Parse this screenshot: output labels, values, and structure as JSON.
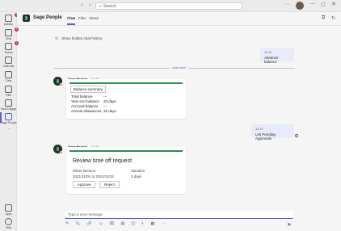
{
  "topbar": {
    "nav": "‹ ›",
    "search_placeholder": "Search",
    "more": "···",
    "minimize": "—",
    "maximize": "▢",
    "close": "✕"
  },
  "rail": {
    "items": [
      {
        "label": "Activity",
        "badge": "99"
      },
      {
        "label": "Chat",
        "badge": "3"
      },
      {
        "label": "Teams",
        "badge": "1"
      },
      {
        "label": "Calendar",
        "badge": ""
      },
      {
        "label": "Calls",
        "badge": ""
      },
      {
        "label": "Files",
        "badge": ""
      },
      {
        "label": "Viva Engage",
        "badge": ""
      },
      {
        "label": "Sage People",
        "badge": ""
      }
    ],
    "more": "···",
    "apps_label": "Apps",
    "help_label": "Help"
  },
  "header": {
    "title": "Sage People",
    "tabs": [
      "Chat",
      "Files",
      "About"
    ]
  },
  "messages": {
    "show_hidden": "Show hidden chat history",
    "me1": {
      "time": "14:47",
      "text": "Absence balance"
    },
    "divider": "Last read",
    "bot1": {
      "name": "Sage People",
      "time": "14:47",
      "card_title": "Balance summary",
      "facts": [
        {
          "k": "Total balance",
          "v": "---"
        },
        {
          "k": "Year end balance",
          "v": "20 days"
        },
        {
          "k": "Accrued balance",
          "v": "---"
        },
        {
          "k": "Annual allowances",
          "v": "25 days"
        }
      ]
    },
    "me2": {
      "time": "14:47",
      "text": "List Pending Approvals"
    },
    "bot2": {
      "name": "Sage People",
      "time": "14:47",
      "title": "Review time off request",
      "employee": "Oliver Benson",
      "dates": "2021/11/01 to 2021/11/03",
      "type": "Vacation",
      "duration": "3 days",
      "approve_label": "Approve",
      "reject_label": "Reject"
    }
  },
  "compose": {
    "placeholder": "Type a new message",
    "toolbar": "✎ 📎 🔗 ☺ ⌧ ▤ ◫ ◐ ▦ ⋯"
  },
  "colors": {
    "accent": "#5b5fc7",
    "card_accent": "#2e8b57"
  }
}
